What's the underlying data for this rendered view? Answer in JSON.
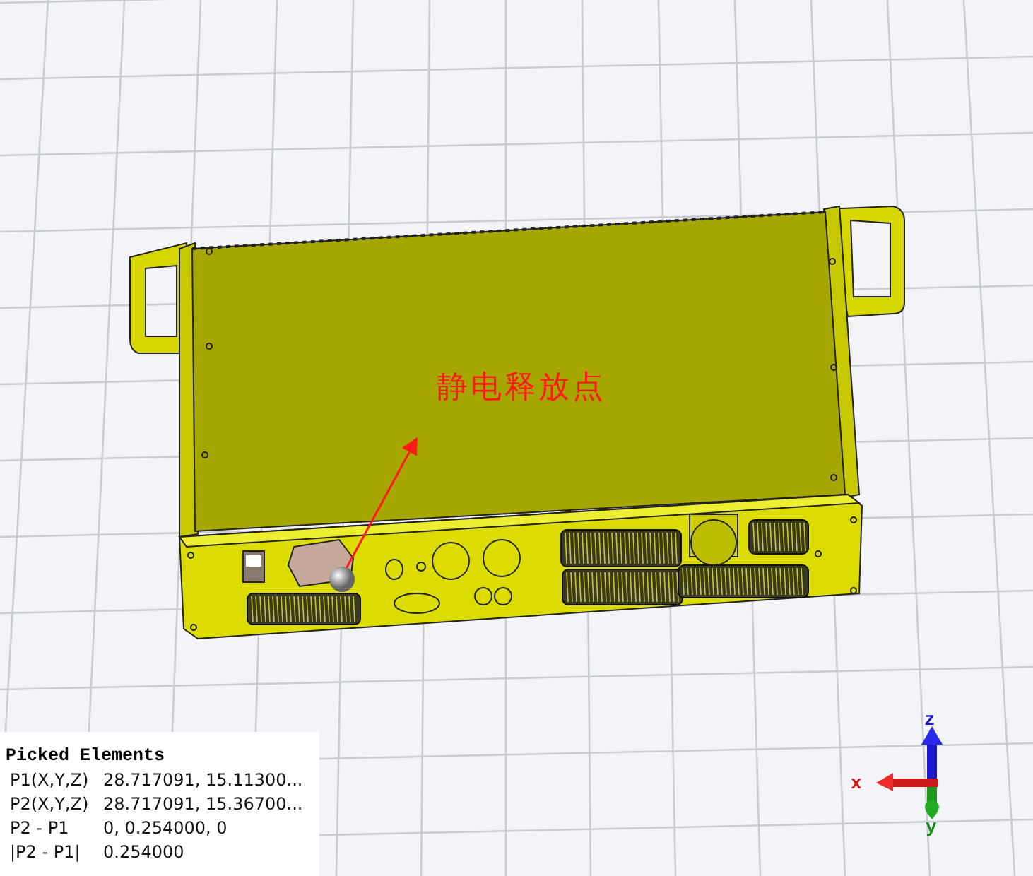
{
  "annotation": {
    "label": "静电释放点"
  },
  "picked_elements": {
    "title": "Picked Elements",
    "rows": [
      {
        "label": "P1(X,Y,Z)",
        "value": "28.717091, 15.11300..."
      },
      {
        "label": "P2(X,Y,Z)",
        "value": "28.717091, 15.36700..."
      },
      {
        "label": "P2 - P1",
        "value": "0, 0.254000, 0"
      },
      {
        "label": "|P2 - P1|",
        "value": "0.254000"
      }
    ]
  },
  "axes": {
    "z": "z",
    "x": "x",
    "y": "y"
  }
}
